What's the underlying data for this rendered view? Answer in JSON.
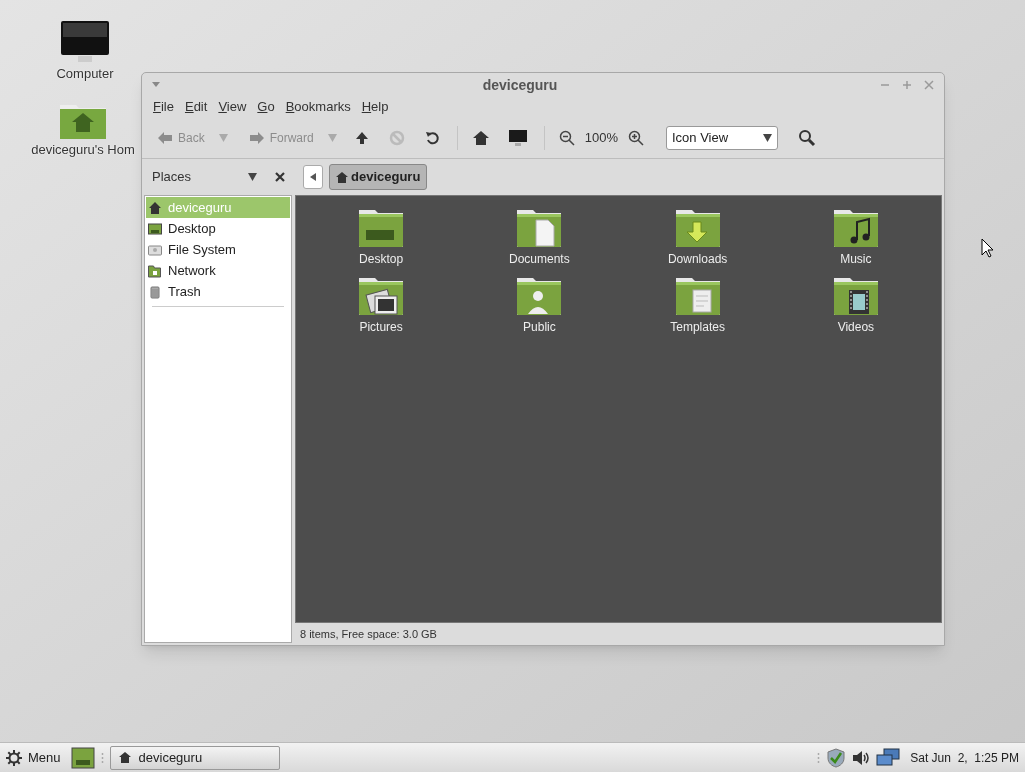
{
  "desktop_icons": [
    {
      "label": "Computer",
      "kind": "computer"
    },
    {
      "label": "deviceguru's Hom",
      "kind": "home"
    }
  ],
  "window": {
    "title": "deviceguru",
    "menu": [
      "File",
      "Edit",
      "View",
      "Go",
      "Bookmarks",
      "Help"
    ],
    "toolbar": {
      "back": {
        "label": "Back",
        "disabled": true
      },
      "forward": {
        "label": "Forward",
        "disabled": true
      },
      "zoom": "100%",
      "view_select": "Icon View"
    },
    "sidebar": {
      "title": "Places",
      "items": [
        {
          "label": "deviceguru",
          "kind": "home",
          "selected": true
        },
        {
          "label": "Desktop",
          "kind": "desktop",
          "selected": false
        },
        {
          "label": "File System",
          "kind": "drive",
          "selected": false
        },
        {
          "label": "Network",
          "kind": "network",
          "selected": false
        },
        {
          "label": "Trash",
          "kind": "trash",
          "selected": false
        }
      ]
    },
    "path": [
      {
        "label": "deviceguru",
        "selected": true
      }
    ],
    "files": [
      {
        "label": "Desktop",
        "kind": "desktop"
      },
      {
        "label": "Documents",
        "kind": "documents"
      },
      {
        "label": "Downloads",
        "kind": "downloads"
      },
      {
        "label": "Music",
        "kind": "music"
      },
      {
        "label": "Pictures",
        "kind": "pictures"
      },
      {
        "label": "Public",
        "kind": "public"
      },
      {
        "label": "Templates",
        "kind": "templates"
      },
      {
        "label": "Videos",
        "kind": "videos"
      }
    ],
    "status_bar": "8 items, Free space: 3.0 GB"
  },
  "taskbar": {
    "menu_label": "Menu",
    "tasks": [
      {
        "label": "deviceguru"
      }
    ],
    "clock": "Sat Jun  2,  1:25 PM"
  }
}
